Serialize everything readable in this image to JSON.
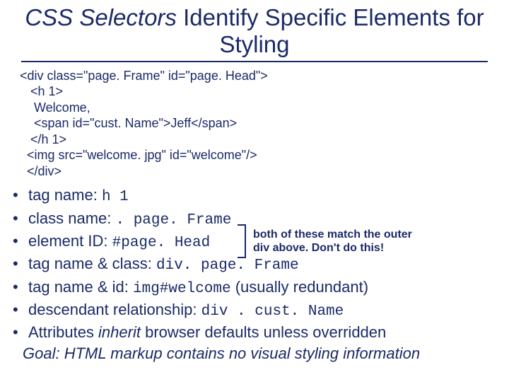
{
  "title": {
    "italic": "CSS Selectors",
    "rest": " Identify Specific Elements for Styling"
  },
  "code": {
    "l1": "<div class=\"page. Frame\" id=\"page. Head\">",
    "l2": "   <h 1>",
    "l3": "    Welcome,",
    "l4": "    <span id=\"cust. Name\">Jeff</span>",
    "l5": "   </h 1>",
    "l6": "  <img src=\"welcome. jpg\" id=\"welcome\"/>",
    "l7": "  </div>"
  },
  "bullets": {
    "b1_label": "tag name: ",
    "b1_code": "h 1",
    "b2_label": "class name:  ",
    "b2_code": ". page. Frame",
    "b3_label": "element ID:   ",
    "b3_code": "#page. Head",
    "b4_label": "tag name & class: ",
    "b4_code": "div. page. Frame",
    "b5_label": "tag name & id: ",
    "b5_code": "img#welcome",
    "b5_suffix": "  (usually redundant)",
    "b6_label": "descendant relationship: ",
    "b6_code": "div . cust. Name",
    "b7_prefix": "Attributes ",
    "b7_em": "inherit",
    "b7_suffix": " browser defaults unless overridden"
  },
  "goal": "Goal: HTML markup contains no visual styling information",
  "annotation": {
    "line1": "both of these match the outer",
    "line2": "div above. Don't do this!"
  }
}
